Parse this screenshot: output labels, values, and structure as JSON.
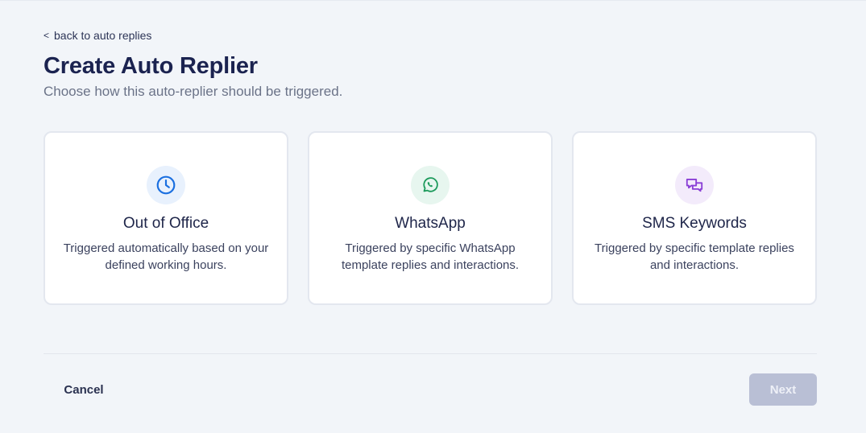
{
  "header": {
    "back_link": "back to auto replies",
    "back_chevron": "<",
    "title": "Create Auto Replier",
    "subtitle": "Choose how this auto-replier should be triggered."
  },
  "cards": [
    {
      "icon": "clock-icon",
      "icon_color": "#1a6fe0",
      "title": "Out of Office",
      "description": "Triggered automatically based on your defined working hours."
    },
    {
      "icon": "whatsapp-icon",
      "icon_color": "#1c9a5b",
      "title": "WhatsApp",
      "description": "Triggered by specific WhatsApp template replies and interactions."
    },
    {
      "icon": "chat-bubbles-icon",
      "icon_color": "#8a3fd6",
      "title": "SMS Keywords",
      "description": "Triggered by specific template replies and interactions."
    }
  ],
  "footer": {
    "cancel_label": "Cancel",
    "next_label": "Next",
    "next_disabled": true
  }
}
